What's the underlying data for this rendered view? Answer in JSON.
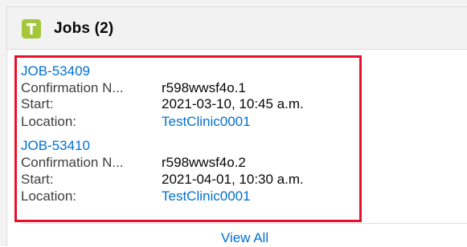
{
  "header": {
    "title": "Jobs (2)",
    "icon": "tool-icon",
    "icon_color": "#a4c639"
  },
  "jobs": [
    {
      "id": "JOB-53409",
      "fields": [
        {
          "label": "Confirmation N...",
          "value": "r598wwsf4o.1",
          "is_link": false
        },
        {
          "label": "Start:",
          "value": "2021-03-10, 10:45 a.m.",
          "is_link": false
        },
        {
          "label": "Location:",
          "value": "TestClinic0001",
          "is_link": true
        }
      ]
    },
    {
      "id": "JOB-53410",
      "fields": [
        {
          "label": "Confirmation N...",
          "value": "r598wwsf4o.2",
          "is_link": false
        },
        {
          "label": "Start:",
          "value": "2021-04-01, 10:30 a.m.",
          "is_link": false
        },
        {
          "label": "Location:",
          "value": "TestClinic0001",
          "is_link": true
        }
      ]
    }
  ],
  "footer": {
    "view_all_label": "View All"
  },
  "colors": {
    "link": "#0070d2",
    "highlight_border": "#e8112d"
  }
}
